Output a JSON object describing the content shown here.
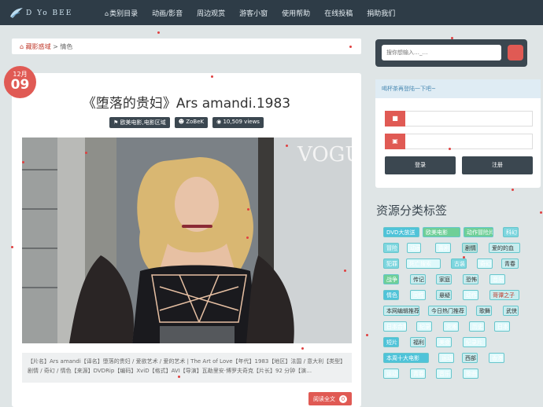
{
  "nav": {
    "logo_text": "D Yo BEE",
    "links": [
      {
        "label": "类别目录"
      },
      {
        "label": "动画/影音"
      },
      {
        "label": "周边观赏"
      },
      {
        "label": "游客小窗"
      },
      {
        "label": "使用帮助"
      },
      {
        "label": "在线投稿"
      },
      {
        "label": "捐助我们"
      }
    ]
  },
  "breadcrumb": {
    "home": "藏影惑域",
    "separator": ">",
    "current": "情色"
  },
  "post": {
    "month": "12月",
    "day": "09",
    "title": "《堕落的贵妇》Ars amandi.1983",
    "meta": {
      "category": "欧美电影,电影区域",
      "author": "ZoBeK",
      "views": "10,509 views"
    },
    "photo_watermark": "VOGU",
    "excerpt": "【片名】Ars amandi【译名】堕落的贵妇 / 爱欲艺术 / 爱的艺术 | The Art of Love【年代】1983【地区】法国 / 意大利【类型】剧情 / 奇幻 / 情色【来源】DVDRip【编码】XviD【格式】AVI【导演】瓦勒里安·博罗夫奇克【片长】92 分钟【演…",
    "read_more": "阅读全文",
    "read_more_count": "0"
  },
  "sidebar": {
    "search_placeholder": "搜你想输入…_…",
    "login_greeting": "喝杯茶再登陆一下吧~",
    "login_button": "登录",
    "register_button": "注册",
    "tags_title": "资源分类标签",
    "tags": [
      {
        "label": "DVD大放送",
        "bg": "#4fc3d9",
        "fg": "#ffffff"
      },
      {
        "label": "欧美电影",
        "bg": "#6fcf97",
        "fg": "#ffffff"
      },
      {
        "label": "动作冒险片",
        "bg": "#6fcf97",
        "fg": "#ffffff"
      },
      {
        "label": "科幻",
        "bg": "#7ed6df",
        "fg": "#ffffff"
      },
      {
        "label": "冒险",
        "bg": "#7ed6df",
        "fg": "#ffffff"
      },
      {
        "label": "动画",
        "bg": "#dff9fb",
        "fg": "#ffffff"
      },
      {
        "label": "喜剧",
        "bg": "#dff9fb",
        "fg": "#ffffff"
      },
      {
        "label": "剧情",
        "bg": "#b2dfdb",
        "fg": "#333333"
      },
      {
        "label": "爱的的血",
        "bg": "#c7ecee",
        "fg": "#333333"
      },
      {
        "label": "犯罪",
        "bg": "#7ed6df",
        "fg": "#ffffff"
      },
      {
        "label": "死亡搜索",
        "bg": "#dff9fb",
        "fg": "#ffffff"
      },
      {
        "label": "古装",
        "bg": "#7ed6df",
        "fg": "#ffffff"
      },
      {
        "label": "奇幻",
        "bg": "#dff9fb",
        "fg": "#ffffff"
      },
      {
        "label": "青春",
        "bg": "#c7ecee",
        "fg": "#333333"
      },
      {
        "label": "战争",
        "bg": "#6fcf97",
        "fg": "#ffffff"
      },
      {
        "label": "传记",
        "bg": "#c7ecee",
        "fg": "#333333"
      },
      {
        "label": "家庭",
        "bg": "#c7ecee",
        "fg": "#333333"
      },
      {
        "label": "恐怖",
        "bg": "#c7ecee",
        "fg": "#333333"
      },
      {
        "label": "音乐",
        "bg": "#dff9fb",
        "fg": "#ffffff"
      },
      {
        "label": "情色",
        "bg": "#4fc3d9",
        "fg": "#ffffff"
      },
      {
        "label": "同性",
        "bg": "#dff9fb",
        "fg": "#ffffff"
      },
      {
        "label": "悬疑",
        "bg": "#c7ecee",
        "fg": "#333333"
      },
      {
        "label": "动作",
        "bg": "#dff9fb",
        "fg": "#ffffff"
      },
      {
        "label": "哥谭之子",
        "bg": "#c7ecee",
        "fg": "#c0392b"
      },
      {
        "label": "本网编辑推荐",
        "bg": "#c7ecee",
        "fg": "#333333"
      },
      {
        "label": "今日热门推荐",
        "bg": "#c7ecee",
        "fg": "#333333"
      },
      {
        "label": "歌舞",
        "bg": "#c7ecee",
        "fg": "#333333"
      },
      {
        "label": "武侠",
        "bg": "#c7ecee",
        "fg": "#333333"
      },
      {
        "label": "日本合集",
        "bg": "#dff9fb",
        "fg": "#ffffff"
      },
      {
        "label": "纪录",
        "bg": "#dff9fb",
        "fg": "#ffffff"
      },
      {
        "label": "灾难",
        "bg": "#dff9fb",
        "fg": "#ffffff"
      },
      {
        "label": "历史",
        "bg": "#dff9fb",
        "fg": "#ffffff"
      },
      {
        "label": "日本",
        "bg": "#dff9fb",
        "fg": "#ffffff"
      },
      {
        "label": "短片",
        "bg": "#4fc3d9",
        "fg": "#ffffff"
      },
      {
        "label": "福利",
        "bg": "#c7ecee",
        "fg": "#333333"
      },
      {
        "label": "美食",
        "bg": "#dff9fb",
        "fg": "#ffffff"
      },
      {
        "label": "纪录片",
        "bg": "#dff9fb",
        "fg": "#ffffff"
      },
      {
        "label": "本周十大电影",
        "bg": "#4fc3d9",
        "fg": "#ffffff"
      },
      {
        "label": "运动",
        "bg": "#dff9fb",
        "fg": "#ffffff"
      },
      {
        "label": "西部",
        "bg": "#c7ecee",
        "fg": "#333333"
      },
      {
        "label": "香港",
        "bg": "#dff9fb",
        "fg": "#ffffff"
      },
      {
        "label": "运动",
        "bg": "#dff9fb",
        "fg": "#ffffff"
      },
      {
        "label": "青春",
        "bg": "#dff9fb",
        "fg": "#ffffff"
      },
      {
        "label": "音乐",
        "bg": "#dff9fb",
        "fg": "#ffffff"
      },
      {
        "label": "歌曲",
        "bg": "#dff9fb",
        "fg": "#ffffff"
      }
    ]
  }
}
